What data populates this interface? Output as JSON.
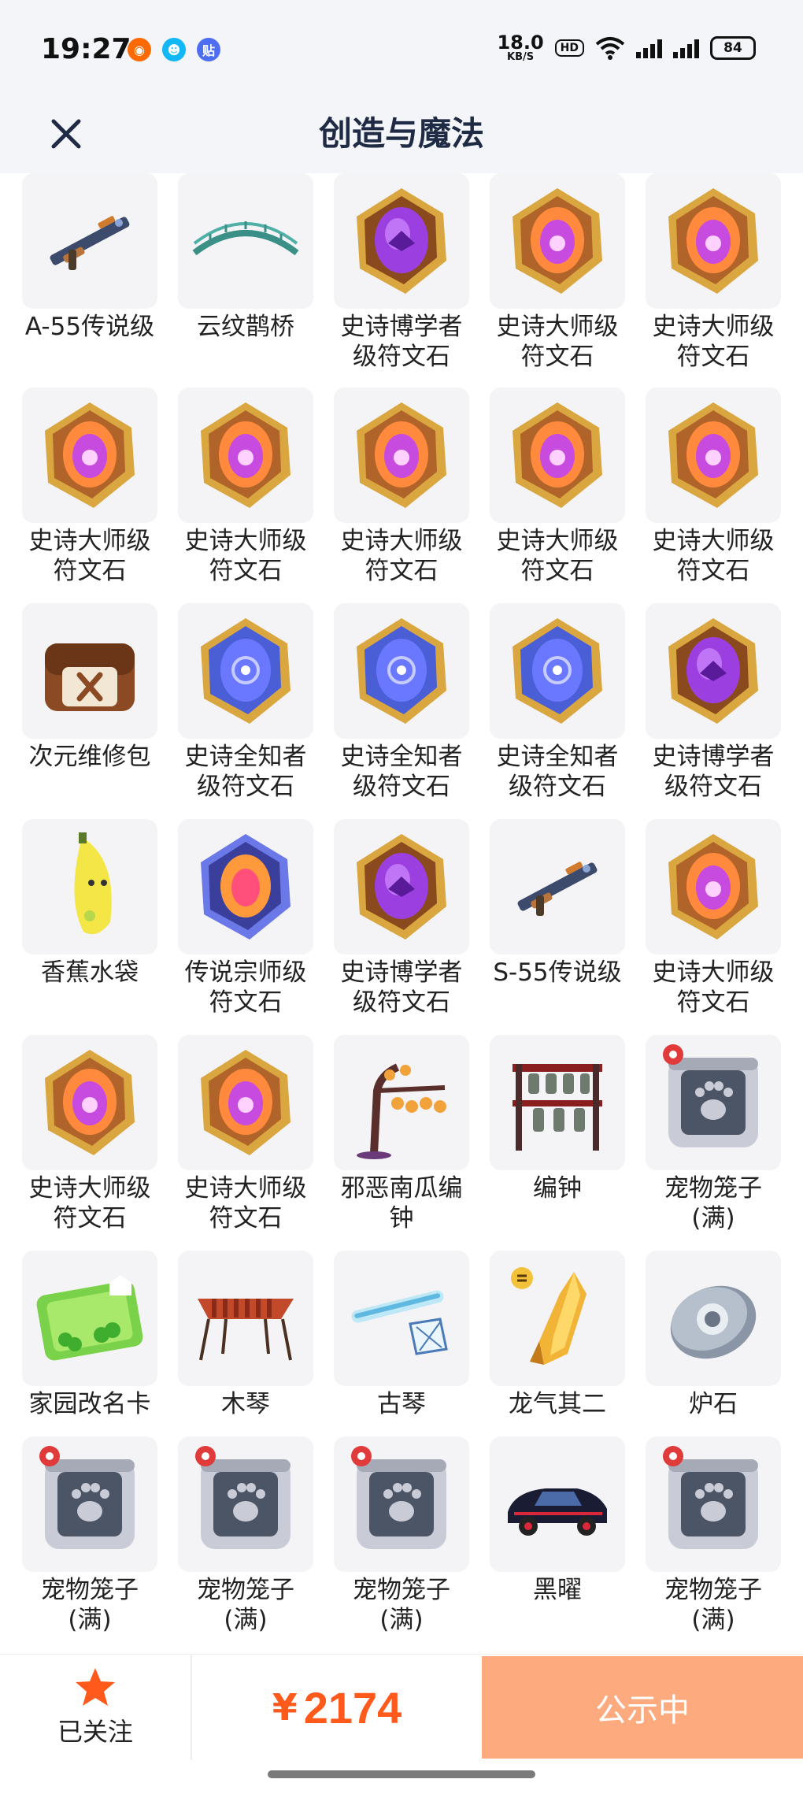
{
  "status_bar": {
    "time": "19:27",
    "net_speed_value": "18.0",
    "net_speed_unit": "KB/S",
    "hd_label": "HD",
    "battery": "84",
    "app_icons": [
      {
        "icon": "taobao-icon",
        "label": "",
        "color": "#ff6a00"
      },
      {
        "icon": "qq-icon",
        "label": "",
        "color": "#12b7f5"
      },
      {
        "icon": "tieba-icon",
        "label": "贴",
        "color": "#4e6ef2"
      }
    ]
  },
  "nav": {
    "title": "创造与魔法",
    "close_icon": "close-icon"
  },
  "items": [
    {
      "label": "A-55传说级",
      "icon": "rifle"
    },
    {
      "label": "云纹鹊桥",
      "icon": "bridge"
    },
    {
      "label": "史诗博学者级符文石",
      "icon": "rune-scholar"
    },
    {
      "label": "史诗大师级符文石",
      "icon": "rune-master"
    },
    {
      "label": "史诗大师级符文石",
      "icon": "rune-master"
    },
    {
      "label": "史诗大师级符文石",
      "icon": "rune-master"
    },
    {
      "label": "史诗大师级符文石",
      "icon": "rune-master"
    },
    {
      "label": "史诗大师级符文石",
      "icon": "rune-master"
    },
    {
      "label": "史诗大师级符文石",
      "icon": "rune-master"
    },
    {
      "label": "史诗大师级符文石",
      "icon": "rune-master"
    },
    {
      "label": "次元维修包",
      "icon": "repair-bag"
    },
    {
      "label": "史诗全知者级符文石",
      "icon": "rune-omniscient"
    },
    {
      "label": "史诗全知者级符文石",
      "icon": "rune-omniscient"
    },
    {
      "label": "史诗全知者级符文石",
      "icon": "rune-omniscient"
    },
    {
      "label": "史诗博学者级符文石",
      "icon": "rune-scholar"
    },
    {
      "label": "香蕉水袋",
      "icon": "banana"
    },
    {
      "label": "传说宗师级符文石",
      "icon": "rune-grandmaster"
    },
    {
      "label": "史诗博学者级符文石",
      "icon": "rune-scholar"
    },
    {
      "label": "S-55传说级",
      "icon": "rifle"
    },
    {
      "label": "史诗大师级符文石",
      "icon": "rune-master"
    },
    {
      "label": "史诗大师级符文石",
      "icon": "rune-master"
    },
    {
      "label": "史诗大师级符文石",
      "icon": "rune-master"
    },
    {
      "label": "邪恶南瓜编钟",
      "icon": "pumpkin-chimes"
    },
    {
      "label": "编钟",
      "icon": "chimes"
    },
    {
      "label": "宠物笼子(满)",
      "icon": "pet-cage"
    },
    {
      "label": "家园改名卡",
      "icon": "rename-card"
    },
    {
      "label": "木琴",
      "icon": "xylophone"
    },
    {
      "label": "古琴",
      "icon": "guqin"
    },
    {
      "label": "龙气其二",
      "icon": "dragon-shard"
    },
    {
      "label": "炉石",
      "icon": "hearthstone"
    },
    {
      "label": "宠物笼子(满)",
      "icon": "pet-cage"
    },
    {
      "label": "宠物笼子(满)",
      "icon": "pet-cage"
    },
    {
      "label": "宠物笼子(满)",
      "icon": "pet-cage"
    },
    {
      "label": "黑曜",
      "icon": "car"
    },
    {
      "label": "宠物笼子(满)",
      "icon": "pet-cage"
    }
  ],
  "bottom": {
    "follow_label": "已关注",
    "follow_icon": "star-icon",
    "currency": "¥",
    "price": "2174",
    "status_label": "公示中"
  }
}
